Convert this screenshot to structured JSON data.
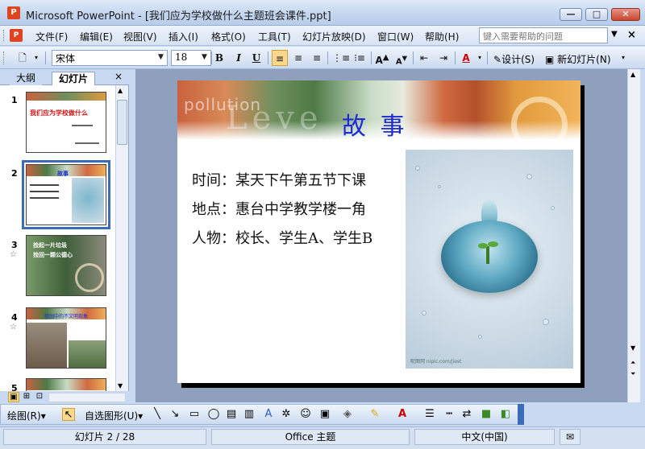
{
  "window": {
    "title": "Microsoft PowerPoint - [我们应为学校做什么主题班会课件.ppt]",
    "app_icon": "P",
    "buttons": {
      "minimize": "—",
      "maximize": "□",
      "close": "✕"
    }
  },
  "menu": {
    "items": [
      "文件(F)",
      "编辑(E)",
      "视图(V)",
      "插入(I)",
      "格式(O)",
      "工具(T)",
      "幻灯片放映(D)",
      "窗口(W)",
      "帮助(H)"
    ],
    "help_placeholder": "键入需要帮助的问题",
    "close_glyph": "×"
  },
  "toolbar": {
    "font_name": "宋体",
    "font_size": "18",
    "bold": "B",
    "italic": "I",
    "underline": "U",
    "font_color_glyph": "A",
    "grow_font": "A",
    "shrink_font": "A",
    "design_label": "设计(S)",
    "new_slide_label": "新幻灯片(N)"
  },
  "left_pane": {
    "tab_outline": "大纲",
    "tab_slides": "幻灯片",
    "close": "×",
    "thumbnails": [
      {
        "number": "1",
        "has_star": false,
        "title": "我们应为学校做什么"
      },
      {
        "number": "2",
        "has_star": false,
        "title": "故事",
        "selected": true
      },
      {
        "number": "3",
        "has_star": true,
        "title": "捡起一片垃圾\n捡回一颗公德心"
      },
      {
        "number": "4",
        "has_star": true,
        "title": "校园中的不文明现象"
      },
      {
        "number": "5",
        "has_star": false,
        "title": ""
      }
    ]
  },
  "slide": {
    "banner_word": "pollution",
    "banner_big": "Leve",
    "title": "故 事",
    "lines": [
      "时间：某天下午第五节下课",
      "地点：惠台中学教学楼一角",
      "人物：校长、学生A、学生B"
    ],
    "photo_credit": "昵图网 nipic.com/jiest"
  },
  "drawing_toolbar": {
    "draw_label": "绘图(R)",
    "autoshapes_label": "自选图形(U)"
  },
  "status": {
    "slide_position": "幻灯片 2 / 28",
    "design_template": "Office 主题",
    "language": "中文(中国)"
  },
  "colors": {
    "title_blue": "#1e2bd3",
    "selection_blue": "#3c6bb8",
    "active_orange": "#fbd88a"
  }
}
